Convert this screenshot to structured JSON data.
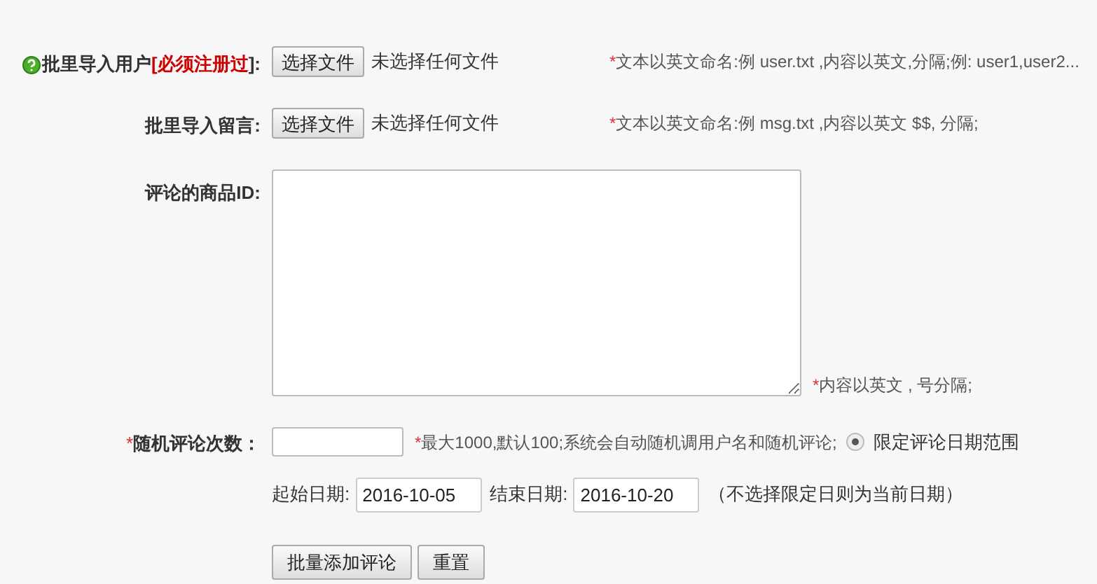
{
  "rows": [
    {
      "kind": "file",
      "help_icon": true,
      "label": "批里导入用户",
      "label_note": "[必须注册过",
      "label_suffix": "]:",
      "button": "选择文件",
      "status": "未选择任何文件",
      "hint_mark": "*",
      "hint": "文本以英文命名:例 user.txt ,内容以英文,分隔;例: user1,user2..."
    },
    {
      "kind": "file",
      "help_icon": false,
      "label": "批里导入留言:",
      "button": "选择文件",
      "status": "未选择任何文件",
      "hint_mark": "*",
      "hint": "文本以英文命名:例 msg.txt ,内容以英文 $$, 分隔;"
    },
    {
      "kind": "textarea",
      "label": "评论的商品ID:",
      "hint_mark": "*",
      "hint": "内容以英文 , 号分隔;"
    },
    {
      "kind": "count",
      "label_mark": "*",
      "label": "随机评论次数：",
      "hint_mark": "*",
      "hint": "最大1000,默认100;系统会自动随机调用户名和随机评论;",
      "radio": {
        "label": "限定评论日期范围",
        "selected": true
      }
    }
  ],
  "dates": {
    "start_label": "起始日期:",
    "start": "2016-10-05",
    "end_label": "结束日期:",
    "end": "2016-10-20",
    "note": "（不选择限定日则为当前日期）"
  },
  "buttons": [
    "批量添加评论",
    "重置"
  ]
}
